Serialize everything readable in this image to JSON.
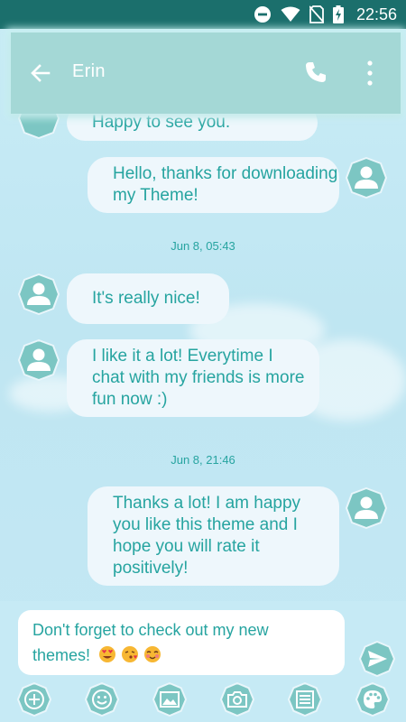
{
  "status_bar": {
    "time": "22:56",
    "icons": [
      "do-not-disturb-icon",
      "wifi-icon",
      "no-sim-icon",
      "battery-charging-icon"
    ]
  },
  "header": {
    "contact_name": "Erin",
    "back_icon": "arrow-back-icon",
    "call_icon": "phone-icon",
    "more_icon": "more-vert-icon",
    "background": "#a4d8d6"
  },
  "messages": [
    {
      "side": "incoming",
      "text": "Happy to see you."
    },
    {
      "side": "outgoing",
      "text": "Hello, thanks for downloading my Theme!"
    },
    {
      "type": "date",
      "text": "Jun 8, 05:43"
    },
    {
      "side": "incoming",
      "text": "It's really nice!"
    },
    {
      "side": "incoming",
      "text": "I like it a lot! Everytime I chat with my friends is more fun now :)"
    },
    {
      "type": "date",
      "text": "Jun 8, 21:46"
    },
    {
      "side": "outgoing",
      "text": "Thanks a lot! I am happy you like this theme and I hope you will rate it positively!"
    }
  ],
  "compose": {
    "text": "Don't forget to check out my new themes!",
    "emojis": [
      "heart-eyes-emoji",
      "kissing-emoji",
      "blushing-emoji"
    ],
    "send_icon": "send-icon"
  },
  "toolbar": [
    "add-icon",
    "emoji-icon",
    "gallery-icon",
    "camera-icon",
    "list-icon",
    "palette-icon"
  ],
  "colors": {
    "status_bar": "#1b6f6c",
    "accent_text": "#26a4a0",
    "bubble": "#eef7fc",
    "icon_teal": "#7cc6c3"
  }
}
